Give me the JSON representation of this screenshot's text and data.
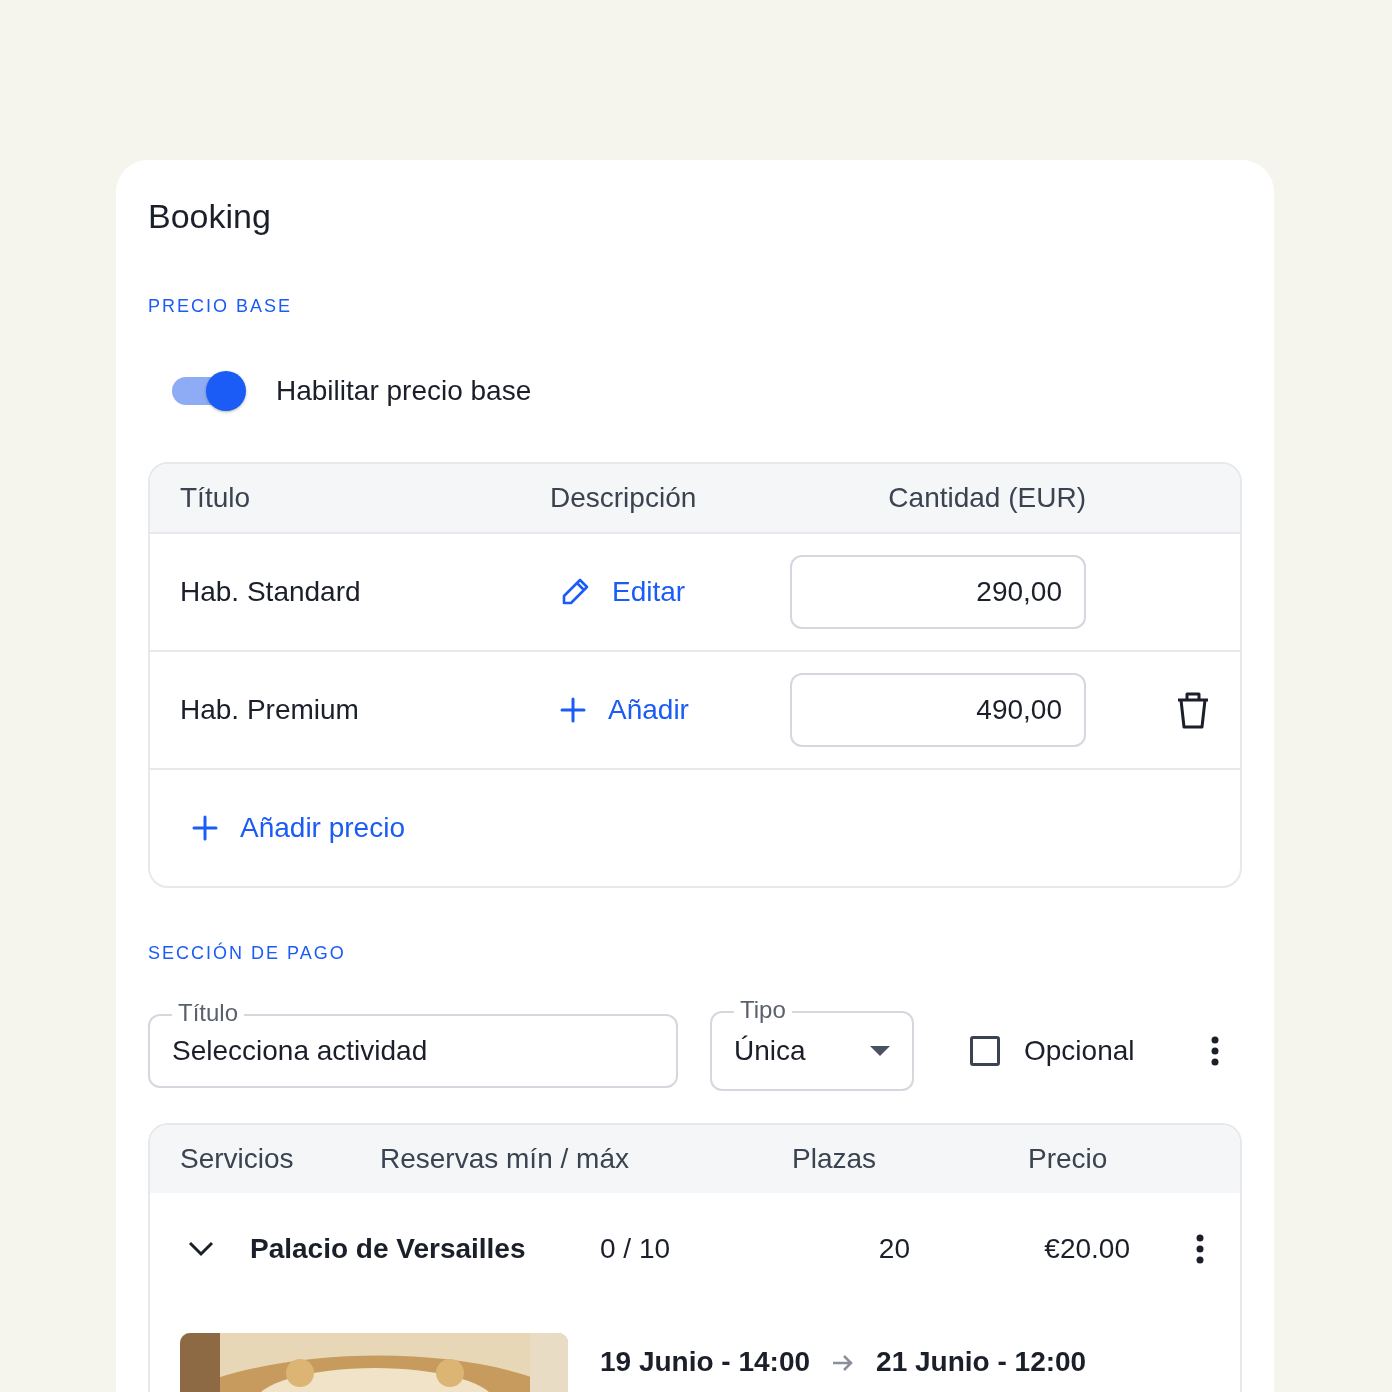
{
  "card": {
    "title": "Booking"
  },
  "base_price": {
    "section_label": "PRECIO BASE",
    "toggle": {
      "label": "Habilitar precio base",
      "on": true
    },
    "columns": [
      "Título",
      "Descripción",
      "Cantidad (EUR)"
    ],
    "rows": [
      {
        "title": "Hab. Standard",
        "action": {
          "kind": "edit",
          "label": "Editar"
        },
        "amount": "290,00",
        "deletable": false
      },
      {
        "title": "Hab. Premium",
        "action": {
          "kind": "add",
          "label": "Añadir"
        },
        "amount": "490,00",
        "deletable": true
      }
    ],
    "add_button": "Añadir precio"
  },
  "payment": {
    "section_label": "SECCIÓN DE PAGO",
    "title_field": {
      "label": "Título",
      "value": "Selecciona actividad"
    },
    "type_field": {
      "label": "Tipo",
      "value": "Única"
    },
    "optional": {
      "label": "Opcional",
      "checked": false
    },
    "columns": [
      "Servicios",
      "Reservas mín / máx",
      "Plazas",
      "Precio"
    ],
    "rows": [
      {
        "name": "Palacio de Versailles",
        "expanded": true,
        "bookings": "0 / 10",
        "seats": "20",
        "price": "€20.00",
        "dates": {
          "start": "19 Junio - 14:00",
          "end": "21 Junio - 12:00"
        }
      }
    ]
  }
}
